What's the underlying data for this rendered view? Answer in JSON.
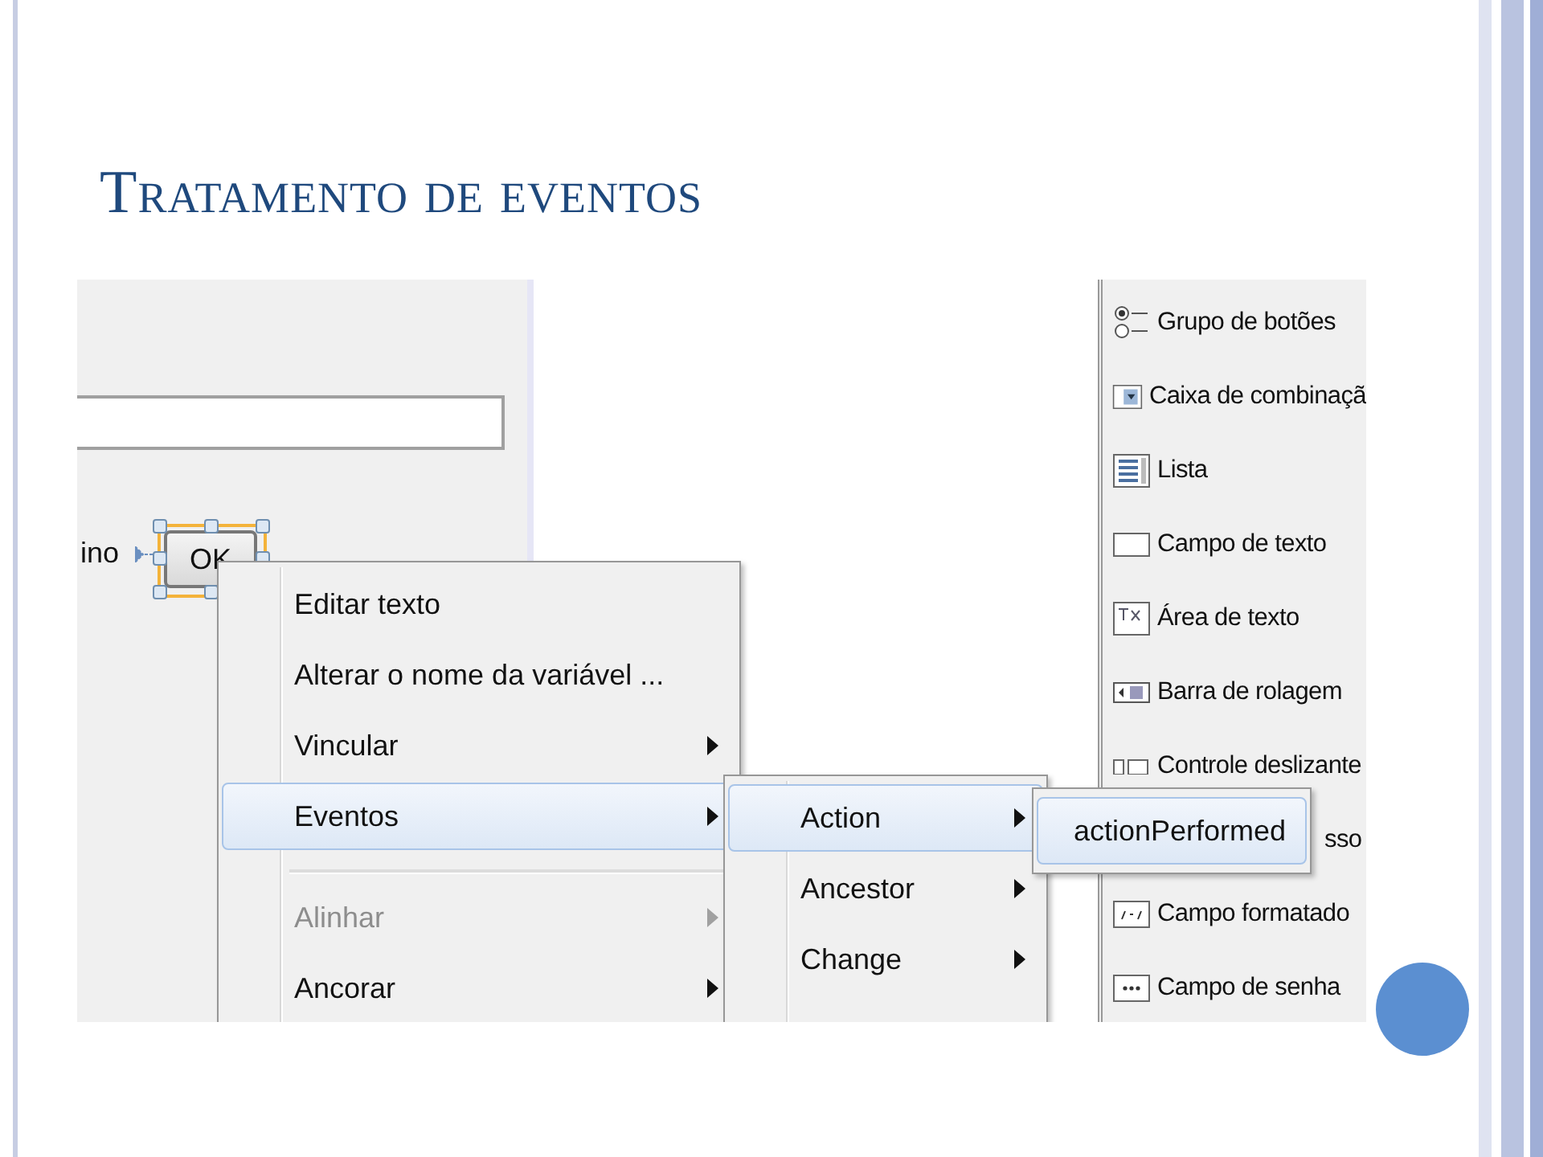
{
  "slide": {
    "title": "Tratamento de eventos"
  },
  "designer": {
    "label": "ino",
    "button": "OK"
  },
  "palette": [
    {
      "kind": "radio",
      "label": "Grupo de botões"
    },
    {
      "kind": "combo",
      "label": "Caixa de combinaçã"
    },
    {
      "kind": "list",
      "label": "Lista"
    },
    {
      "kind": "field",
      "label": "Campo de texto"
    },
    {
      "kind": "area",
      "label": "Área de texto"
    },
    {
      "kind": "scroll",
      "label": "Barra de rolagem"
    },
    {
      "kind": "slider",
      "label": "Controle deslizante"
    },
    {
      "kind": "hidden",
      "label": "sso"
    },
    {
      "kind": "formatted",
      "label": "Campo formatado"
    },
    {
      "kind": "password",
      "label": "Campo de senha"
    }
  ],
  "context_menu": [
    {
      "kind": "item",
      "label": "Editar texto",
      "submenu": false,
      "selected": false,
      "disabled": false
    },
    {
      "kind": "item",
      "label": "Alterar o nome da variável ...",
      "submenu": false,
      "selected": false,
      "disabled": false
    },
    {
      "kind": "item",
      "label": "Vincular",
      "submenu": true,
      "selected": false,
      "disabled": false
    },
    {
      "kind": "item",
      "label": "Eventos",
      "submenu": true,
      "selected": true,
      "disabled": false
    },
    {
      "kind": "separator"
    },
    {
      "kind": "item",
      "label": "Alinhar",
      "submenu": true,
      "selected": false,
      "disabled": true
    },
    {
      "kind": "item",
      "label": "Ancorar",
      "submenu": true,
      "selected": false,
      "disabled": false
    }
  ],
  "events_menu": [
    {
      "label": "Action",
      "submenu": true,
      "selected": true
    },
    {
      "label": "Ancestor",
      "submenu": true,
      "selected": false
    },
    {
      "label": "Change",
      "submenu": true,
      "selected": false
    }
  ],
  "action_menu": [
    {
      "label": "actionPerformed",
      "selected": true
    }
  ]
}
